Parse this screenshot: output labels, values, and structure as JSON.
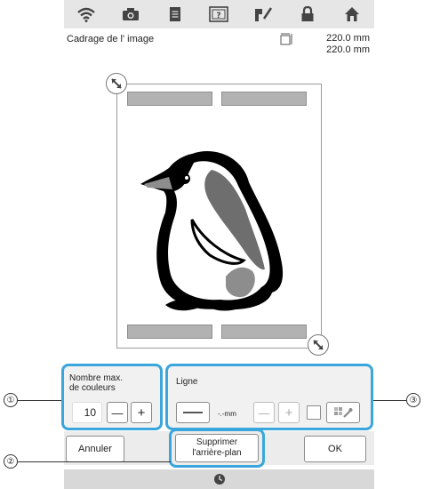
{
  "header": {
    "title": "Cadrage de l' image",
    "width_value": "220.0 mm",
    "height_value": "220.0 mm",
    "icons": [
      "wifi-icon",
      "camera-icon",
      "document-icon",
      "help-icon",
      "thread-icon",
      "lock-icon",
      "home-icon"
    ]
  },
  "colors_section": {
    "label_line1": "Nombre max.",
    "label_line2": "de couleurs",
    "value": "10",
    "minus": "—",
    "plus": "+"
  },
  "line_section": {
    "label": "Ligne",
    "thickness_value": "-.-mm",
    "minus": "—",
    "plus": "+"
  },
  "buttons": {
    "cancel": "Annuler",
    "remove_bg_line1": "Supprimer",
    "remove_bg_line2": "l'arrière-plan",
    "ok": "OK"
  },
  "callouts": [
    "①",
    "②",
    "③"
  ],
  "colors": {
    "highlight": "#3aa6dc",
    "bar": "#e6e6e6"
  }
}
